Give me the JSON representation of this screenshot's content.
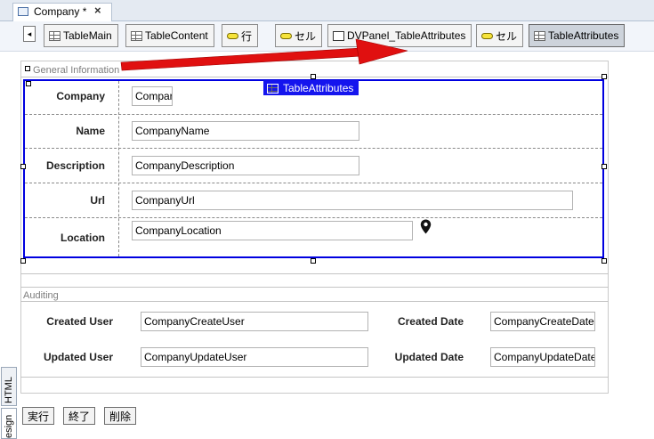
{
  "tab": {
    "title": "Company *",
    "close": "×",
    "icon": "form-icon"
  },
  "toolbar": {
    "nav_left": "◂",
    "crumbs": [
      {
        "label": "TableMain",
        "icon": "table-icon"
      },
      {
        "label": "TableContent",
        "icon": "table-icon"
      },
      {
        "label": "行",
        "icon": "cell-icon"
      },
      {
        "label": "セル",
        "icon": "cell-icon"
      },
      {
        "label": "DVPanel_TableAttributes",
        "icon": "panel-icon"
      },
      {
        "label": "セル",
        "icon": "cell-icon"
      },
      {
        "label": "TableAttributes",
        "icon": "table-icon"
      }
    ]
  },
  "sections": {
    "general": "General Information",
    "auditing": "Auditing"
  },
  "selection_tag": "TableAttributes",
  "attributes": [
    {
      "label": "Company",
      "value": "Compar"
    },
    {
      "label": "Name",
      "value": "CompanyName"
    },
    {
      "label": "Description",
      "value": "CompanyDescription"
    },
    {
      "label": "Url",
      "value": "CompanyUrl"
    },
    {
      "label": "Location",
      "value": "CompanyLocation"
    }
  ],
  "location_icon": "map-pin-icon",
  "auditing": [
    {
      "label": "Created User",
      "value": "CompanyCreateUser"
    },
    {
      "label": "Created Date",
      "value": "CompanyCreateDate"
    },
    {
      "label": "Updated User",
      "value": "CompanyUpdateUser"
    },
    {
      "label": "Updated Date",
      "value": "CompanyUpdateDate"
    }
  ],
  "buttons": {
    "execute": "実行",
    "finish": "終了",
    "delete": "削除"
  },
  "side_tabs": {
    "html": "HTML",
    "design": "esign"
  },
  "colors": {
    "selection": "#0000e0",
    "arrow": "#e01010",
    "tag_bg": "#1515ee"
  }
}
